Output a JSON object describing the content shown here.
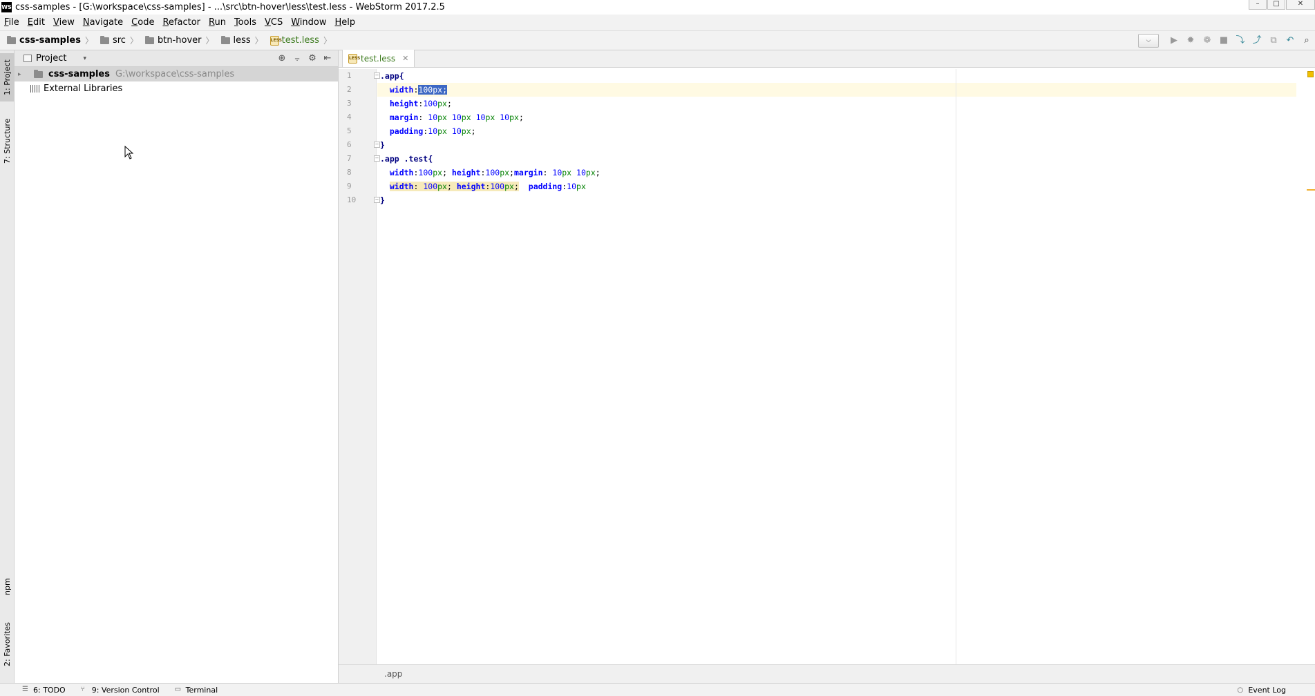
{
  "window": {
    "logo": "WS",
    "title": "css-samples - [G:\\workspace\\css-samples] - ...\\src\\btn-hover\\less\\test.less - WebStorm 2017.2.5",
    "controls": [
      "–",
      "□",
      "✕"
    ]
  },
  "menu": [
    "File",
    "Edit",
    "View",
    "Navigate",
    "Code",
    "Refactor",
    "Run",
    "Tools",
    "VCS",
    "Window",
    "Help"
  ],
  "breadcrumb": [
    {
      "label": "css-samples",
      "kind": "project"
    },
    {
      "label": "src",
      "kind": "folder"
    },
    {
      "label": "btn-hover",
      "kind": "folder"
    },
    {
      "label": "less",
      "kind": "folder"
    },
    {
      "label": "test.less",
      "kind": "file"
    }
  ],
  "toolbar": {
    "combo_arrow": "⌵",
    "buttons": [
      {
        "name": "run-icon",
        "glyph": "▶"
      },
      {
        "name": "debug-icon",
        "glyph": "✹"
      },
      {
        "name": "coverage-icon",
        "glyph": "❁"
      },
      {
        "name": "stop-icon",
        "glyph": "■"
      },
      {
        "name": "vcs-update-icon",
        "glyph": "⤵"
      },
      {
        "name": "vcs-commit-icon",
        "glyph": "⤴"
      },
      {
        "name": "vcs-compare-icon",
        "glyph": "⧉"
      },
      {
        "name": "vcs-revert-icon",
        "glyph": "↶"
      },
      {
        "name": "search-icon",
        "glyph": "⌕"
      }
    ]
  },
  "left_stripe": {
    "project": "1: Project",
    "structure": "7: Structure",
    "npm": "npm",
    "favorites": "2: Favorites"
  },
  "project_panel": {
    "title": "Project",
    "dropdown": "▾",
    "tools": [
      "⊕",
      "⨪",
      "⚙",
      "⇤"
    ],
    "tree": [
      {
        "label": "css-samples",
        "path": "G:\\workspace\\css-samples",
        "expand": "▸"
      },
      {
        "label": "External Libraries"
      }
    ]
  },
  "editor": {
    "tab_label": "test.less",
    "tab_close": "✕",
    "file_icon": "LESS",
    "line_numbers": [
      "1",
      "2",
      "3",
      "4",
      "5",
      "6",
      "7",
      "8",
      "9",
      "10"
    ],
    "lines": [
      ".app{",
      "  width:100px;",
      "  height:100px;",
      "  margin: 10px 10px 10px 10px;",
      "  padding:10px 10px;",
      "}",
      ".app .test{",
      "  width:100px; height:100px;margin: 10px 10px;",
      "  width: 100px; height:100px;  padding:10px",
      "}"
    ],
    "fold_marks": [
      "−",
      "−",
      "−",
      "−"
    ],
    "breadcrumb": ".app"
  },
  "statusbar": {
    "todo": "6: TODO",
    "version_control": "9: Version Control",
    "terminal": "Terminal",
    "event_log": "Event Log"
  }
}
